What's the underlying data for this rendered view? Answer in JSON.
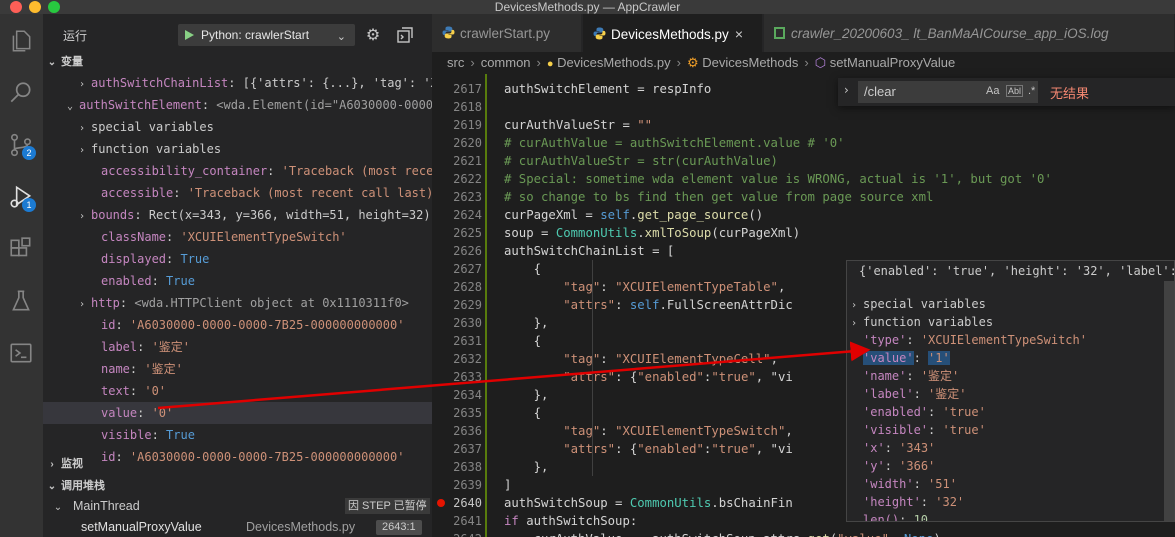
{
  "window": {
    "title": "DevicesMethods.py — AppCrawler"
  },
  "activity_bar": {
    "items": [
      {
        "name": "explorer-icon"
      },
      {
        "name": "search-icon"
      },
      {
        "name": "source-control-icon",
        "badge": "2"
      },
      {
        "name": "run-debug-icon",
        "badge": "1"
      },
      {
        "name": "extensions-icon"
      },
      {
        "name": "testing-icon"
      },
      {
        "name": "remote-explorer-icon"
      }
    ]
  },
  "run_panel": {
    "title": "运行",
    "config": "Python: crawlerStart"
  },
  "variables": {
    "header": "变量",
    "rows": [
      {
        "name": "authSwitchChainList",
        "sep": ": ",
        "value": "[{'attrs': {...}, 'tag': 'XCUIE..."
      },
      {
        "name": "authSwitchElement",
        "sep": ": ",
        "value": "<wda.Element(id=\"A6030000-0000-00..."
      },
      {
        "name": "special variables",
        "sep": "",
        "value": ""
      },
      {
        "name": "function variables",
        "sep": "",
        "value": ""
      },
      {
        "name": "accessibility_container",
        "sep": ": ",
        "value": "'Traceback (most recent c..."
      },
      {
        "name": "accessible",
        "sep": ": ",
        "value": "'Traceback (most recent call last):\\n ..."
      },
      {
        "name": "bounds",
        "sep": ": ",
        "value": "Rect(x=343, y=366, width=51, height=32)"
      },
      {
        "name": "className",
        "sep": ": ",
        "value": "'XCUIElementTypeSwitch'"
      },
      {
        "name": "displayed",
        "sep": ": ",
        "value": "True"
      },
      {
        "name": "enabled",
        "sep": ": ",
        "value": "True"
      },
      {
        "name": "http",
        "sep": ": ",
        "value": "<wda.HTTPClient object at 0x1110311f0>"
      },
      {
        "name": "id",
        "sep": ": ",
        "value": "'A6030000-0000-0000-7B25-000000000000'"
      },
      {
        "name": "label",
        "sep": ": ",
        "value": "'鉴定'"
      },
      {
        "name": "name",
        "sep": ": ",
        "value": "'鉴定'"
      },
      {
        "name": "text",
        "sep": ": ",
        "value": "'0'"
      },
      {
        "name": "value",
        "sep": ": ",
        "value": "'0'"
      },
      {
        "name": "visible",
        "sep": ": ",
        "value": "True"
      },
      {
        "name": "id",
        "sep": ": ",
        "value": "'A6030000-0000-0000-7B25-000000000000'"
      }
    ]
  },
  "watch": {
    "header": "监视"
  },
  "callstack": {
    "header": "调用堆栈",
    "thread": "MainThread",
    "thread_status": "因 STEP 已暂停",
    "frame_name": "setManualProxyValue",
    "frame_file": "DevicesMethods.py",
    "frame_line": "2643:1"
  },
  "tabs": [
    {
      "label": "crawlerStart.py",
      "icon": "python-file-icon",
      "active": false
    },
    {
      "label": "DevicesMethods.py",
      "icon": "python-file-icon",
      "active": true,
      "close": "×"
    },
    {
      "label": "crawler_20200603_        lt_BanMaAICourse_app_iOS.log",
      "icon": "log-file-icon",
      "active": false
    }
  ],
  "breadcrumb": [
    "src",
    "common",
    "DevicesMethods.py",
    "DevicesMethods",
    "setManualProxyValue"
  ],
  "find_widget": {
    "value": "/clear",
    "opt_case": "Aa",
    "opt_word": "Abl",
    "opt_regex": ".*",
    "result": "无结果"
  },
  "code": {
    "line_numbers": [
      "2617",
      "2618",
      "2619",
      "2620",
      "2621",
      "2622",
      "2623",
      "2624",
      "2625",
      "2626",
      "2627",
      "2628",
      "2629",
      "2630",
      "2631",
      "2632",
      "2633",
      "2634",
      "2635",
      "2636",
      "2637",
      "2638",
      "2639",
      "2640",
      "2641",
      "2642"
    ],
    "lines": [
      "authSwitchElement = respInfo",
      "",
      "curAuthValueStr = \"\"",
      "# curAuthValue = authSwitchElement.value # '0'",
      "# curAuthValueStr = str(curAuthValue)",
      "# Special: sometime wda element value is WRONG, actual is '1', but got '0'",
      "# so change to bs find then get value from page source xml",
      "curPageXml = self.get_page_source()",
      "soup = CommonUtils.xmlToSoup(curPageXml)",
      "authSwitchChainList = [",
      "    {",
      "        \"tag\": \"XCUIElementTypeTable\",",
      "        \"attrs\": self.FullScreenAttrDic",
      "    },",
      "    {",
      "        \"tag\": \"XCUIElementTypeCell\",",
      "        \"attrs\": {\"enabled\":\"true\", \"vi",
      "    },",
      "    {",
      "        \"tag\": \"XCUIElementTypeSwitch\",",
      "        \"attrs\": {\"enabled\":\"true\", \"vi",
      "    },",
      "]",
      "authSwitchSoup = CommonUtils.bsChainFin",
      "if authSwitchSoup:",
      "    curAuthValue =  authSwitchSoup.attrs.get(\"value\", None)"
    ]
  },
  "hover": {
    "header": "{'enabled': 'true', 'height': '32', 'label': ...",
    "rows": [
      {
        "key": "special variables",
        "value": ""
      },
      {
        "key": "function variables",
        "value": ""
      },
      {
        "key": "'type'",
        "value": "'XCUIElementTypeSwitch'"
      },
      {
        "key": "'value'",
        "value": "'1'"
      },
      {
        "key": "'name'",
        "value": "'鉴定'"
      },
      {
        "key": "'label'",
        "value": "'鉴定'"
      },
      {
        "key": "'enabled'",
        "value": "'true'"
      },
      {
        "key": "'visible'",
        "value": "'true'"
      },
      {
        "key": "'x'",
        "value": "'343'"
      },
      {
        "key": "'y'",
        "value": "'366'"
      },
      {
        "key": "'width'",
        "value": "'51'"
      },
      {
        "key": "'height'",
        "value": "'32'"
      },
      {
        "key": "len()",
        "value": "10"
      }
    ]
  },
  "colors": {
    "accent": "#1c7bd3",
    "annotation_arrow": "#e00000",
    "breakpoint": "#e51400"
  }
}
